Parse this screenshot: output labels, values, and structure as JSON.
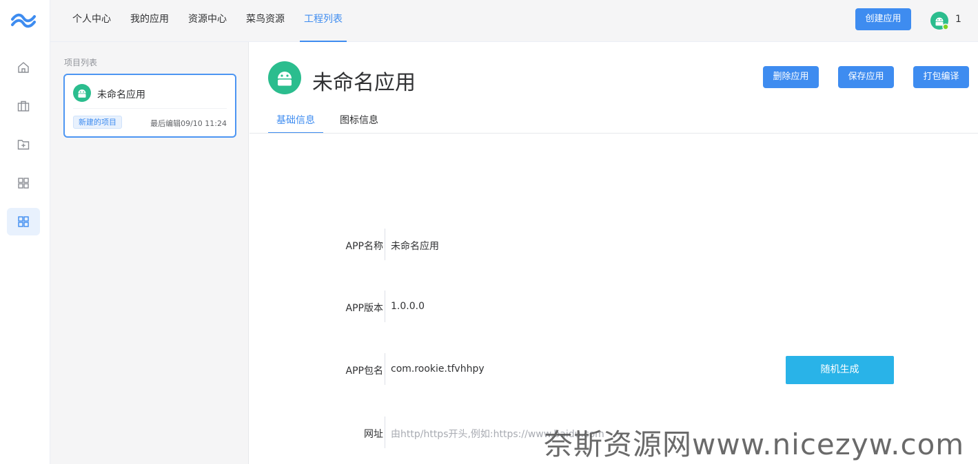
{
  "rail": {
    "items": [
      {
        "icon": "home-icon"
      },
      {
        "icon": "briefcase-icon"
      },
      {
        "icon": "folder-add-icon"
      },
      {
        "icon": "grid-icon"
      },
      {
        "icon": "grid-icon"
      }
    ],
    "active_index": 4,
    "accent": "#3e8cf0"
  },
  "topbar": {
    "tabs": [
      "个人中心",
      "我的应用",
      "资源中心",
      "菜鸟资源",
      "工程列表"
    ],
    "active_tab": "工程列表",
    "create_button": "创建应用",
    "notification_count": "1"
  },
  "panel": {
    "title": "项目列表",
    "project": {
      "name": "未命名应用",
      "badge": "新建的项目",
      "last_edit": "最后编辑09/10 11:24"
    }
  },
  "main": {
    "app_name": "未命名应用",
    "actions": {
      "delete": "删除应用",
      "save": "保存应用",
      "build": "打包编译"
    },
    "tabs": [
      "基础信息",
      "图标信息"
    ],
    "active_tab": "基础信息",
    "form": {
      "name_label": "APP名称",
      "name_value": "未命名应用",
      "version_label": "APP版本",
      "version_value": "1.0.0.0",
      "package_label": "APP包名",
      "package_value": "com.rookie.tfvhhpy",
      "random_button": "随机生成",
      "url_label": "网址",
      "url_placeholder": "由http/https开头,例如:https://www.baidu.com"
    }
  },
  "watermark": "奈斯资源网www.nicezyw.com",
  "colors": {
    "primary": "#3e8cf0",
    "random_button": "#29b3e8",
    "android_green": "#2bbd8e"
  }
}
